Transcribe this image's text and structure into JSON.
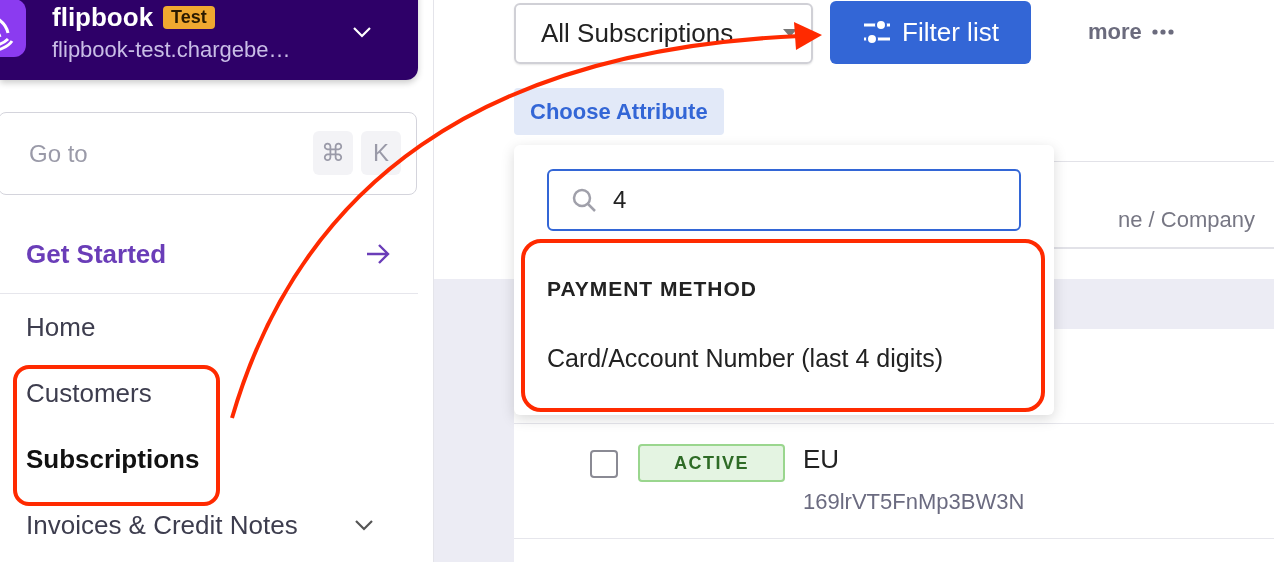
{
  "org": {
    "name": "flipbook",
    "badge": "Test",
    "domain": "flipbook-test.chargebe…"
  },
  "goto": {
    "placeholder": "Go to",
    "keys": [
      "⌘",
      "K"
    ]
  },
  "get_started": "Get Started",
  "nav": [
    {
      "label": "Home",
      "selected": false,
      "expandable": false
    },
    {
      "label": "Customers",
      "selected": false,
      "expandable": false
    },
    {
      "label": "Subscriptions",
      "selected": true,
      "expandable": false
    },
    {
      "label": "Invoices & Credit Notes",
      "selected": false,
      "expandable": true
    }
  ],
  "toolbar": {
    "view": "All Subscriptions",
    "filter_button": "Filter list",
    "more": "more"
  },
  "choose_attribute": "Choose Attribute",
  "attribute_menu": {
    "search": "4",
    "groups": [
      {
        "heading": "PAYMENT METHOD",
        "items": [
          "Card/Account Number (last 4 digits)"
        ]
      }
    ]
  },
  "table": {
    "column_header": "ne / Company",
    "rows": [
      {
        "checked": false,
        "status": "ACTIVE",
        "name": "EU",
        "id": "169lrVT5FnMp3BW3N"
      }
    ]
  }
}
